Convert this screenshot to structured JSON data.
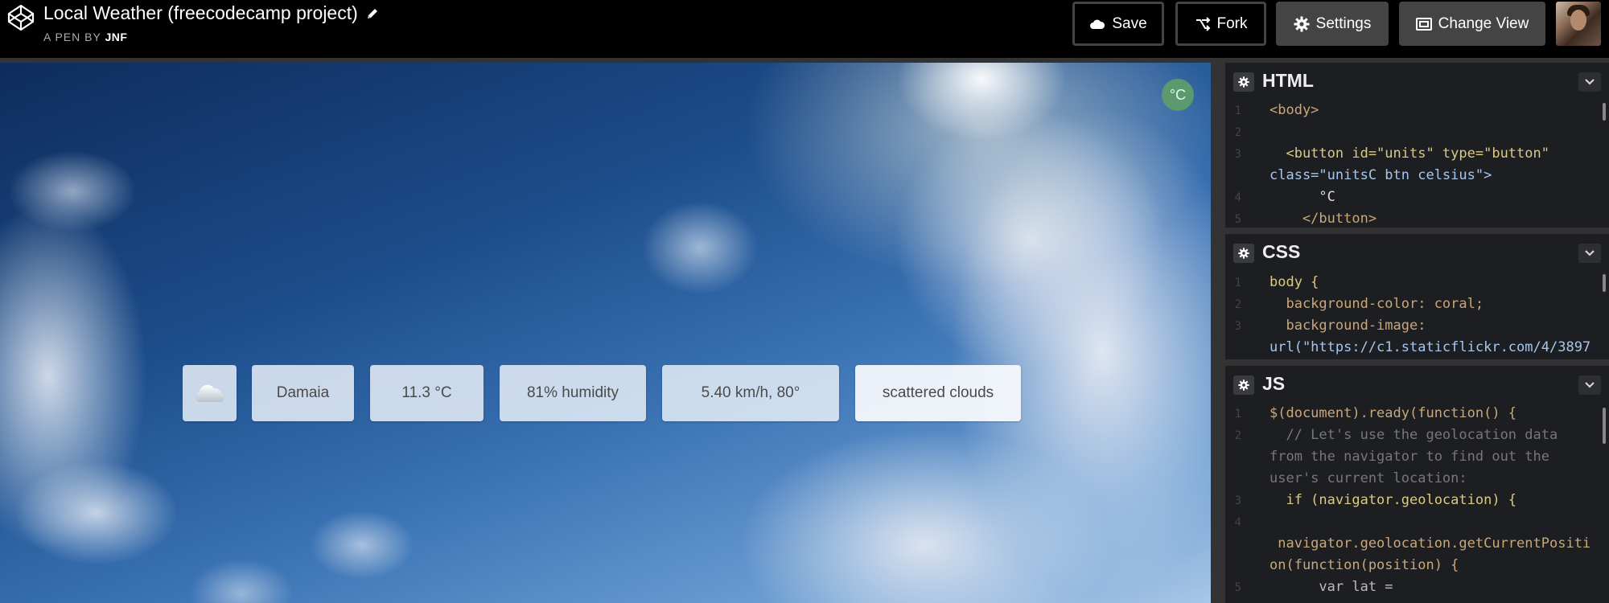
{
  "header": {
    "title": "Local Weather (freecodecamp project)",
    "byline_prefix": "A PEN BY",
    "author": "JNF",
    "buttons": {
      "save": "Save",
      "fork": "Fork",
      "settings": "Settings",
      "change_view": "Change View"
    },
    "icons": {
      "logo": "codepen-logo-icon",
      "edit": "pencil-icon",
      "save": "cloud-icon",
      "fork": "fork-icon",
      "settings": "gear-icon",
      "change_view": "layout-icon"
    }
  },
  "preview": {
    "units_button": "°C",
    "weather_icon": "cloud-icon",
    "city": "Damaia",
    "temperature": "11.3 °C",
    "humidity": "81% humidity",
    "wind": "5.40 km/h, 80°",
    "description": "scattered clouds"
  },
  "editors": {
    "html": {
      "title": "HTML",
      "lines": [
        {
          "n": "1",
          "fold": "▾",
          "code": "<body>"
        },
        {
          "n": "2",
          "fold": "",
          "code": ""
        },
        {
          "n": "3",
          "fold": "▾",
          "code": "  <button id=\"units\" type=\"button\""
        },
        {
          "n": "",
          "fold": "",
          "code": "class=\"unitsC btn celsius\">"
        },
        {
          "n": "4",
          "fold": "",
          "code": "      °C"
        },
        {
          "n": "5",
          "fold": "",
          "code": "    </button>"
        }
      ]
    },
    "css": {
      "title": "CSS",
      "lines": [
        {
          "n": "1",
          "fold": "▾",
          "code": "body {"
        },
        {
          "n": "2",
          "fold": "",
          "code": "  background-color: coral;"
        },
        {
          "n": "3",
          "fold": "",
          "code": "  background-image:"
        },
        {
          "n": "",
          "fold": "",
          "code": "url(\"https://c1.staticflickr.com/4/3897"
        }
      ]
    },
    "js": {
      "title": "JS",
      "lines": [
        {
          "n": "1",
          "fold": "▾",
          "code": "$(document).ready(function() {"
        },
        {
          "n": "2",
          "fold": "",
          "code": "  // Let's use the geolocation data"
        },
        {
          "n": "",
          "fold": "",
          "code": "from the navigator to find out the"
        },
        {
          "n": "",
          "fold": "",
          "code": "user's current location:"
        },
        {
          "n": "3",
          "fold": "▾",
          "code": "  if (navigator.geolocation) {"
        },
        {
          "n": "4",
          "fold": "▾",
          "code": ""
        },
        {
          "n": "",
          "fold": "",
          "code": " navigator.geolocation.getCurrentPositi"
        },
        {
          "n": "",
          "fold": "",
          "code": "on(function(position) {"
        },
        {
          "n": "5",
          "fold": "",
          "code": "      var lat ="
        }
      ]
    }
  }
}
